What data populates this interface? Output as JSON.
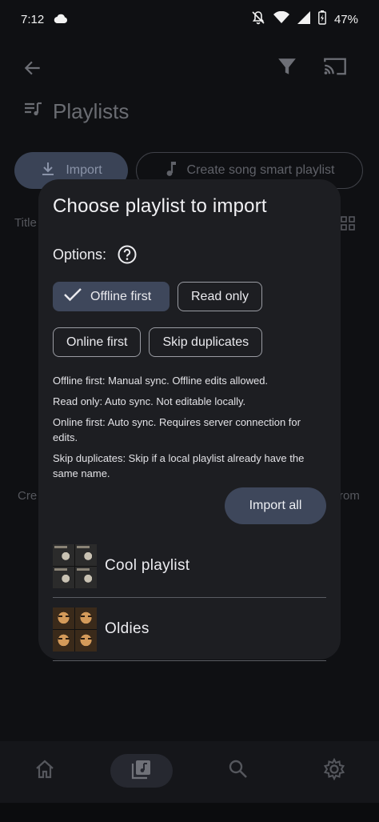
{
  "status_bar": {
    "time": "7:12",
    "battery": "47%",
    "icons": [
      "cloud-icon",
      "notifications-off-icon",
      "wifi-icon",
      "signal-icon",
      "battery-charging-icon"
    ]
  },
  "background": {
    "title": "Playlists",
    "import_label": "Import",
    "smart_label": "Create song smart playlist",
    "column_title": "Title",
    "empty_left": "Cre",
    "empty_right": "rom"
  },
  "dialog": {
    "title": "Choose playlist to import",
    "options_label": "Options:",
    "chips": [
      {
        "label": "Offline first",
        "selected": true
      },
      {
        "label": "Read only",
        "selected": false
      },
      {
        "label": "Online first",
        "selected": false
      },
      {
        "label": "Skip duplicates",
        "selected": false
      }
    ],
    "descriptions": [
      "Offline first: Manual sync. Offline edits allowed.",
      "Read only: Auto sync. Not editable locally.",
      "Online first: Auto sync. Requires server connection for edits.",
      "Skip duplicates: Skip if a local playlist already have the same name."
    ],
    "import_all": "Import all",
    "playlists": [
      {
        "name": "Cool playlist"
      },
      {
        "name": "Oldies"
      }
    ]
  },
  "colors": {
    "dialog_bg": "#1d1e22",
    "accent": "#3e475b",
    "screen_bg": "#0f1013"
  }
}
